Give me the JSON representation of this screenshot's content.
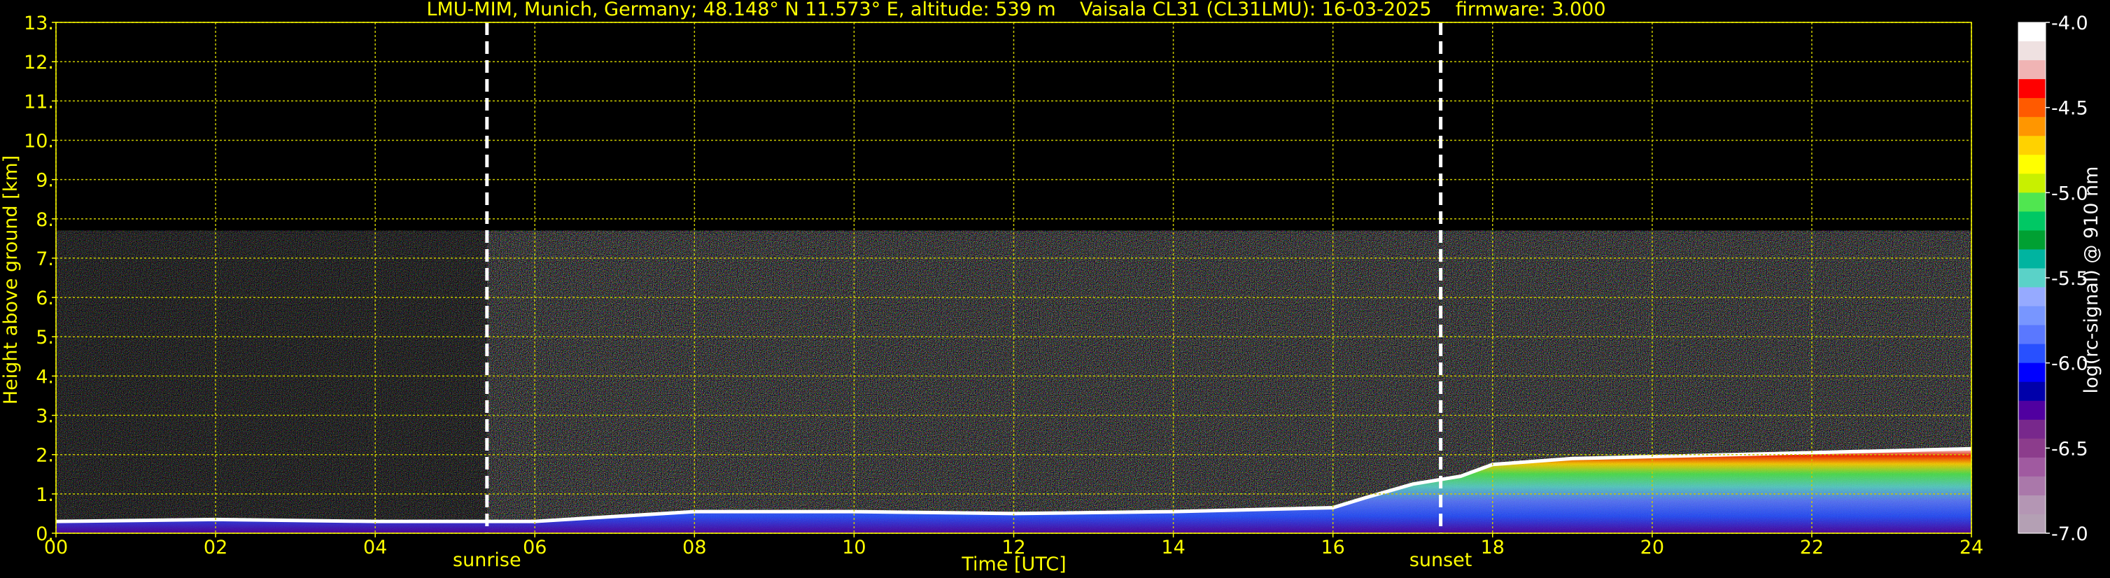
{
  "chart_data": {
    "type": "heatmap",
    "title": "LMU-MIM, Munich, Germany; 48.148° N 11.573° E, altitude: 539 m    Vaisala CL31 (CL31LMU): 16-03-2025    firmware: 3.000",
    "xlabel": "Time [UTC]",
    "ylabel": "Height above ground [km]",
    "colorbar_label": "log(rc-signal) @ 910 nm",
    "xlim": [
      0,
      24
    ],
    "ylim": [
      0,
      13
    ],
    "clim": [
      -7.0,
      -4.0
    ],
    "grid": true,
    "x_ticks": [
      "00",
      "02",
      "04",
      "06",
      "08",
      "10",
      "12",
      "14",
      "16",
      "18",
      "20",
      "22",
      "24"
    ],
    "x_tick_values": [
      0,
      2,
      4,
      6,
      8,
      10,
      12,
      14,
      16,
      18,
      20,
      22,
      24
    ],
    "y_ticks": [
      "0.",
      "1.",
      "2.",
      "3.",
      "4.",
      "5.",
      "6.",
      "7.",
      "8.",
      "9.",
      "10.",
      "11.",
      "12.",
      "13."
    ],
    "y_tick_values": [
      0,
      1,
      2,
      3,
      4,
      5,
      6,
      7,
      8,
      9,
      10,
      11,
      12,
      13
    ],
    "colorbar_ticks": [
      "-4.0",
      "-4.5",
      "-5.0",
      "-5.5",
      "-6.0",
      "-6.5",
      "-7.0"
    ],
    "colorbar_tick_values": [
      -4.0,
      -4.5,
      -5.0,
      -5.5,
      -6.0,
      -6.5,
      -7.0
    ],
    "colorbar_colors": [
      "#ffffff",
      "#efe1e1",
      "#f0b4b4",
      "#ff0000",
      "#ff5a00",
      "#ff9600",
      "#ffd200",
      "#ffff00",
      "#c8f000",
      "#50e650",
      "#00c864",
      "#00a032",
      "#00b4a0",
      "#5ad2c8",
      "#96aaff",
      "#7896ff",
      "#5a78ff",
      "#2850ff",
      "#0000ff",
      "#0000aa",
      "#5000a0",
      "#78288c",
      "#8c3c8c",
      "#a05aa0",
      "#aa78aa",
      "#b496b4",
      "#b4a0b4"
    ],
    "data_top_km": 7.7,
    "annotations": [
      {
        "label": "sunrise",
        "time": 5.4
      },
      {
        "label": "sunset",
        "time": 17.35
      }
    ],
    "cloud_layer_height_km": [
      [
        0,
        0.3
      ],
      [
        2,
        0.35
      ],
      [
        4,
        0.3
      ],
      [
        5.4,
        0.3
      ],
      [
        6,
        0.3
      ],
      [
        8,
        0.55
      ],
      [
        10,
        0.55
      ],
      [
        12,
        0.5
      ],
      [
        14,
        0.55
      ],
      [
        16,
        0.65
      ],
      [
        16.4,
        0.9
      ],
      [
        17,
        1.25
      ],
      [
        17.6,
        1.45
      ],
      [
        18,
        1.75
      ],
      [
        19,
        1.9
      ],
      [
        20,
        1.95
      ],
      [
        21,
        2.0
      ],
      [
        22,
        2.05
      ],
      [
        23,
        2.1
      ],
      [
        24,
        2.15
      ]
    ]
  }
}
